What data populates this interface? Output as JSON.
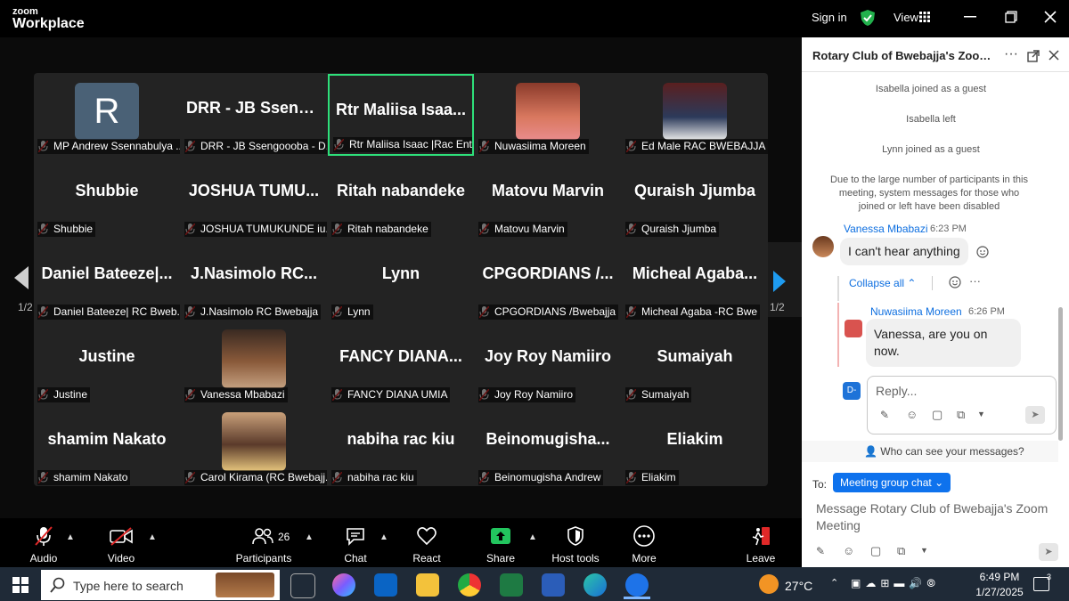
{
  "app": {
    "logo_top": "zoom",
    "logo_bottom": "Workplace",
    "sign_in": "Sign in",
    "view": "View"
  },
  "stage": {
    "page_left": "1/2",
    "page_right": "1/2"
  },
  "tiles": [
    {
      "big": "",
      "avatar_letter": "R",
      "name": "MP Andrew Ssennabulya ..."
    },
    {
      "big": "DRR - JB Sseng...",
      "name": "DRR - JB Ssengoooba - D..."
    },
    {
      "big": "Rtr Maliisa Isaa...",
      "name": "Rtr Maliisa Isaac |Rac Entebb..."
    },
    {
      "big": "",
      "name": "Nuwasiima Moreen"
    },
    {
      "big": "",
      "name": "Ed Male RAC BWEBAJJA"
    },
    {
      "big": "Shubbie",
      "name": "Shubbie"
    },
    {
      "big": "JOSHUA TUMU...",
      "name": "JOSHUA TUMUKUNDE iu..."
    },
    {
      "big": "Ritah nabandeke",
      "name": "Ritah nabandeke"
    },
    {
      "big": "Matovu Marvin",
      "name": "Matovu Marvin"
    },
    {
      "big": "Quraish Jjumba",
      "name": "Quraish Jjumba"
    },
    {
      "big": "Daniel Bateeze|...",
      "name": "Daniel Bateeze| RC Bweb..."
    },
    {
      "big": "J.Nasimolo RC...",
      "name": "J.Nasimolo RC Bwebajja"
    },
    {
      "big": "Lynn",
      "name": "Lynn"
    },
    {
      "big": "CPGORDIANS /...",
      "name": "CPGORDIANS /Bwebajja"
    },
    {
      "big": "Micheal Agaba...",
      "name": "Micheal Agaba -RC Bwe"
    },
    {
      "big": "Justine",
      "name": "Justine"
    },
    {
      "big": "",
      "name": "Vanessa Mbabazi"
    },
    {
      "big": "FANCY DIANA...",
      "name": "FANCY DIANA UMIA"
    },
    {
      "big": "Joy Roy Namiiro",
      "name": "Joy Roy Namiiro"
    },
    {
      "big": "Sumaiyah",
      "name": "Sumaiyah"
    },
    {
      "big": "shamim Nakato",
      "name": "shamim Nakato"
    },
    {
      "big": "",
      "name": "Carol Kirama (RC Bwebajj..."
    },
    {
      "big": "nabiha rac kiu",
      "name": "nabiha rac kiu"
    },
    {
      "big": "Beinomugisha...",
      "name": "Beinomugisha Andrew"
    },
    {
      "big": "Eliakim",
      "name": "Eliakim"
    }
  ],
  "toolbar": {
    "audio": "Audio",
    "video": "Video",
    "participants": "Participants",
    "participants_count": "26",
    "chat": "Chat",
    "react": "React",
    "share": "Share",
    "host_tools": "Host tools",
    "more": "More",
    "leave": "Leave"
  },
  "chat": {
    "title": "Rotary Club of Bwebajja's Zoom ...",
    "sys1": "Isabella joined as a guest",
    "sys2": "Isabella left",
    "sys3": "Lynn joined as a guest",
    "sys4": "Due to the large number of participants in this meeting, system messages for those who joined or left have been disabled",
    "msg1_sender": "Vanessa Mbabazi",
    "msg1_time": "6:23 PM",
    "msg1_text": "I can't hear anything",
    "collapse": "Collapse all",
    "msg2_sender": "Nuwasiima Moreen",
    "msg2_time": "6:26 PM",
    "msg2_text": "Vanessa, are you on now.",
    "reply_avatar": "D-",
    "reply_placeholder": "Reply...",
    "who_can_see": "Who can see your messages?",
    "to_label": "To:",
    "to_value": "Meeting group chat",
    "message_placeholder": "Message Rotary Club of Bwebajja's Zoom Meeting"
  },
  "taskbar": {
    "search_placeholder": "Type here to search",
    "temp": "27°C",
    "time": "6:49 PM",
    "date": "1/27/2025",
    "notif_count": "3"
  }
}
